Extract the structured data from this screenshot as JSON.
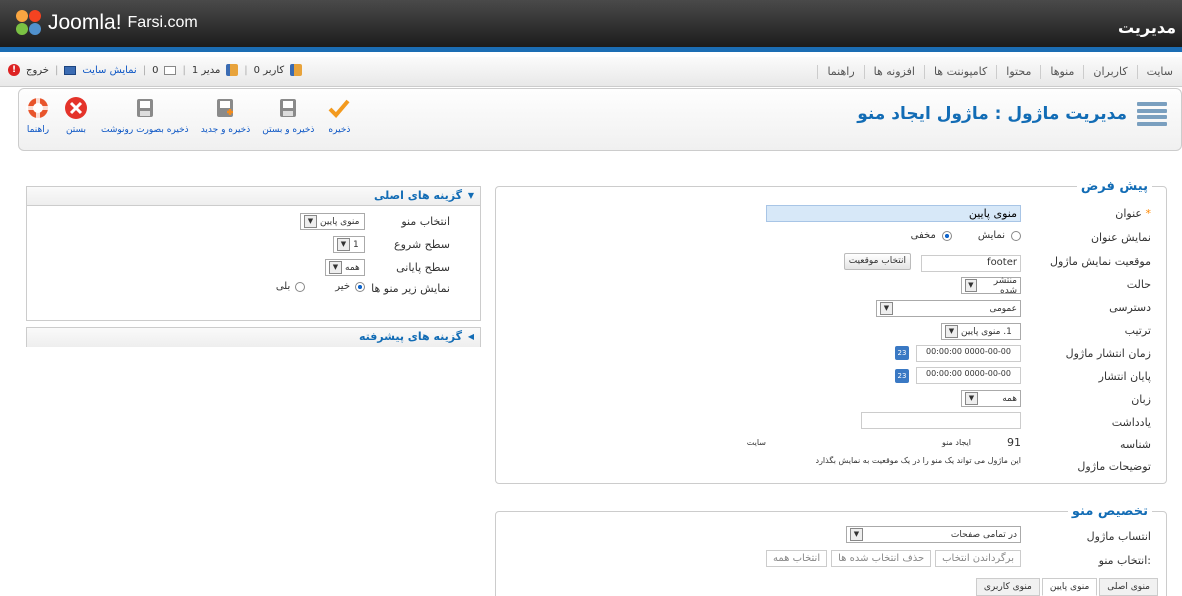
{
  "topbar": {
    "logo_text": "Joomla!",
    "logo_suffix": "Farsi.com",
    "admin_title": "مدیریت"
  },
  "menu": [
    "سایت",
    "کاربران",
    "منوها",
    "محتوا",
    "کامپوننت ها",
    "افزونه ها",
    "راهنما"
  ],
  "status": {
    "users": "0 کاربر",
    "admins": "1 مدیر",
    "messages": "0",
    "view_site": "نمایش سایت",
    "logout": "خروج"
  },
  "toolbar": {
    "save": "ذخیره",
    "save_close": "ذخیره و بستن",
    "save_new": "ذخیره و جدید",
    "save_copy": "ذخیره بصورت رونوشت",
    "close": "بستن",
    "help": "راهنما"
  },
  "page_title": "مدیریت ماژول : ماژول ایجاد منو",
  "details": {
    "legend": "پیش فرض",
    "title_label": "عنوان",
    "required_mark": "*",
    "title_value": "منوی پایین",
    "show_title_label": "نمایش عنوان",
    "show_option": "نمایش",
    "hide_option": "مخفی",
    "position_label": "موقعیت نمایش ماژول",
    "position_value": "footer",
    "select_position_button": "انتخاب موقعیت",
    "state_label": "حالت",
    "state_value": "منتشر شده",
    "access_label": "دسترسی",
    "access_value": "عمومی",
    "ordering_label": "ترتیب",
    "ordering_value": "1. منوی پایین",
    "publish_up_label": "زمان انتشار ماژول",
    "publish_up_value": "00:00:00 0000-00-00",
    "publish_down_label": "پایان انتشار",
    "publish_down_value": "00:00:00 0000-00-00",
    "calendar_icon_text": "23",
    "language_label": "زبان",
    "language_value": "همه",
    "note_label": "یادداشت",
    "note_value": "",
    "id_label": "شناسه",
    "id_value": "91",
    "id_type": "ایجاد منو",
    "id_client": "سایت",
    "desc_label": "توضیحات ماژول",
    "desc_value": "این ماژول می تواند یک منو را در یک موقعیت به نمایش بگذارد"
  },
  "assignment": {
    "legend": "تخصیص منو",
    "assign_label": "انتساب ماژول",
    "assign_value": "در تمامی صفحات",
    "menu_select_label": "انتخاب منو:",
    "btn_toggle": "برگرداندن انتخاب",
    "btn_clear": "حذف انتخاب شده ها",
    "btn_all": "انتخاب همه",
    "tabs": [
      "منوی اصلی",
      "منوی پایین",
      "منوی کاربری"
    ]
  },
  "basic_options": {
    "title": "گزینه های اصلی",
    "menu_label": "انتخاب منو",
    "menu_value": "منوی پایین",
    "start_label": "سطح شروع",
    "start_value": "1",
    "end_label": "سطح پایانی",
    "end_value": "همه",
    "sub_label": "نمایش زیر منو ها",
    "no_option": "خیر",
    "yes_option": "بلی"
  },
  "advanced_options": {
    "title": "گزینه های پیشرفته"
  }
}
